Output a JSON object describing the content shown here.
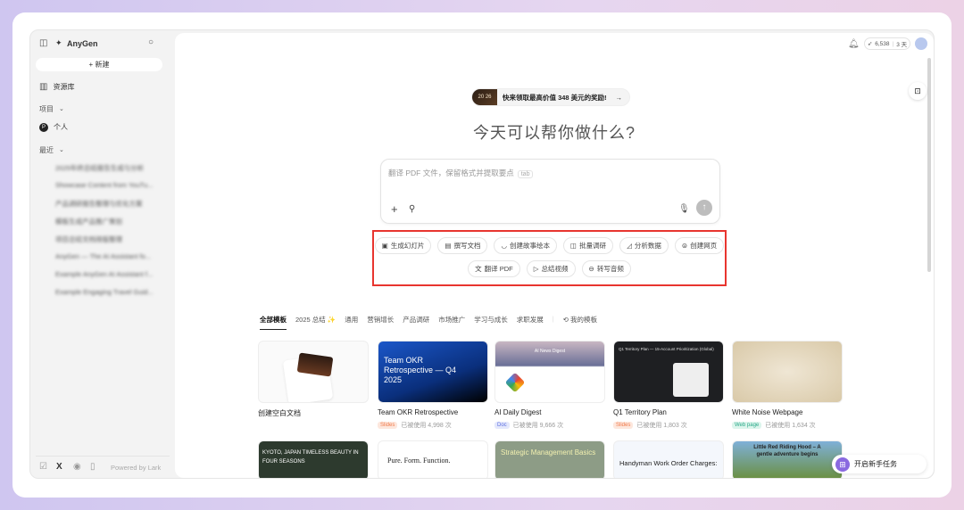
{
  "sidebar": {
    "app_name": "AnyGen",
    "new_label": "+ 新建",
    "library": "资源库",
    "projects": "项目",
    "personal": "个人",
    "personal_avatar": "P",
    "recent": "最近",
    "recent_items": [
      "2025年终总结报告生成与分析",
      "Showcase Content from YouTu...",
      "产品调研报告整理与优化方案",
      "模板生成产品推广策划",
      "项目总结文档排版整理",
      "AnyGen — The AI Assistant fo...",
      "Example AnyGen AI Assistant f...",
      "Example Engaging Travel Guid..."
    ],
    "footer": "Powered by Lark"
  },
  "topbar": {
    "credits": "6,538",
    "days": "3 天"
  },
  "banner": {
    "year": "20 26",
    "text": "快来领取最高价值 348 美元的奖励!",
    "arrow": "→"
  },
  "heading": "今天可以帮你做什么?",
  "prompt": {
    "placeholder": "翻译 PDF 文件，保留格式并提取要点",
    "tab_hint": "tab"
  },
  "quick_actions": [
    "生成幻灯片",
    "撰写文档",
    "创建故事绘本",
    "批量调研",
    "分析数据",
    "创建网页",
    "翻译 PDF",
    "总结视频",
    "转写音频"
  ],
  "template_tabs": [
    "全部模板",
    "2025 总结 ✨",
    "通用",
    "营销增长",
    "产品调研",
    "市场推广",
    "学习与成长",
    "求职发展",
    "我的模板"
  ],
  "templates": [
    {
      "name": "创建空白文档"
    },
    {
      "name": "Team OKR Retrospective",
      "thumb_title": "Team OKR Retrospective — Q4 2025",
      "badge": "Slides",
      "uses": "已被使用 4,998 次"
    },
    {
      "name": "AI Daily Digest",
      "thumb_title": "AI News Digest",
      "badge": "Doc",
      "uses": "已被使用 9,666 次"
    },
    {
      "name": "Q1 Territory Plan",
      "thumb_title": "Q1 Territory Plan — 15-Account Prioritization (Global)",
      "badge": "Slides",
      "uses": "已被使用 1,803 次"
    },
    {
      "name": "White Noise Webpage",
      "badge": "Web page",
      "uses": "已被使用 1,634 次"
    }
  ],
  "templates_row2": [
    "KYOTO, JAPAN TIMELESS BEAUTY IN FOUR SEASONS",
    "Pure. Form. Function.",
    "Strategic Management Basics",
    "Handyman Work Order Charges:",
    "Little Red Riding Hood – A gentle adventure begins"
  ],
  "new_task": "开启新手任务",
  "colors": {
    "highlight": "#e8352f",
    "slides": "#f07a4a",
    "doc": "#5b6ee0",
    "web": "#2aa889"
  }
}
